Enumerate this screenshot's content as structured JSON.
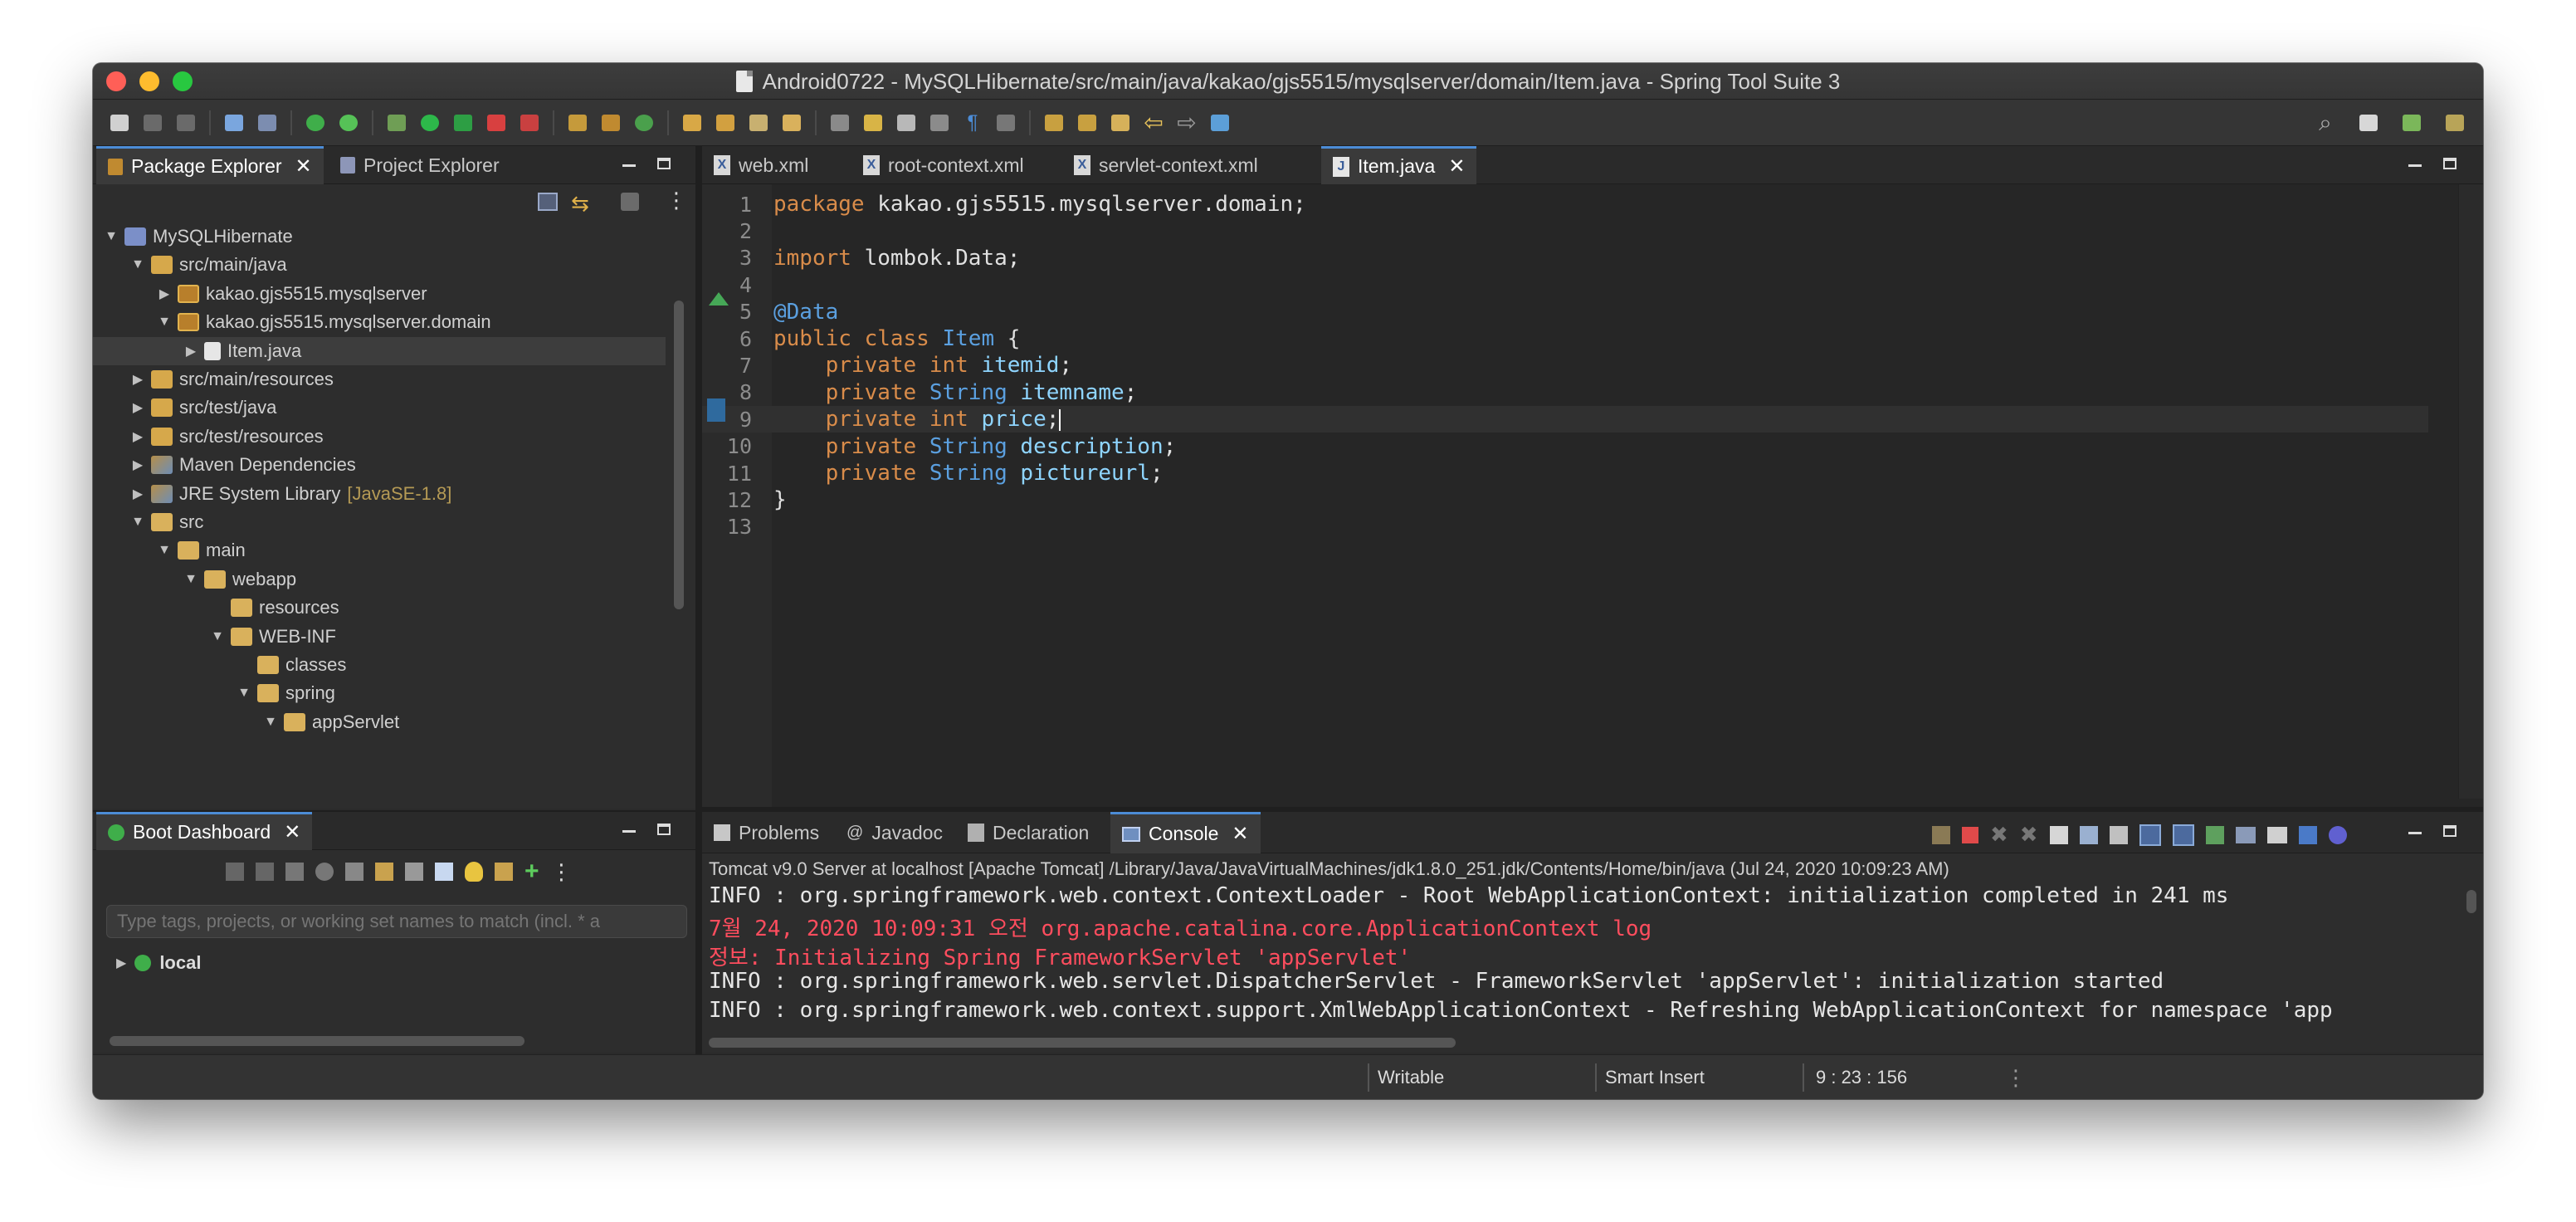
{
  "window": {
    "title": "Android0722 - MySQLHibernate/src/main/java/kakao/gjs5515/mysqlserver/domain/Item.java - Spring Tool Suite 3"
  },
  "package_explorer": {
    "tabs": [
      {
        "label": "Package Explorer",
        "active": true
      },
      {
        "label": "Project Explorer",
        "active": false
      }
    ],
    "tree": [
      {
        "label": "MySQLHibernate",
        "icon": "project-icon",
        "depth": 0,
        "twisty": "open"
      },
      {
        "label": "src/main/java",
        "icon": "source-folder-icon",
        "depth": 1,
        "twisty": "open"
      },
      {
        "label": "kakao.gjs5515.mysqlserver",
        "icon": "package-icon",
        "depth": 2,
        "twisty": "closed"
      },
      {
        "label": "kakao.gjs5515.mysqlserver.domain",
        "icon": "package-icon",
        "depth": 2,
        "twisty": "open"
      },
      {
        "label": "Item.java",
        "icon": "java-file-icon",
        "depth": 3,
        "twisty": "closed",
        "selected": true
      },
      {
        "label": "src/main/resources",
        "icon": "source-folder-icon",
        "depth": 1,
        "twisty": "closed"
      },
      {
        "label": "src/test/java",
        "icon": "source-folder-icon",
        "depth": 1,
        "twisty": "closed"
      },
      {
        "label": "src/test/resources",
        "icon": "source-folder-icon",
        "depth": 1,
        "twisty": "closed"
      },
      {
        "label": "Maven Dependencies",
        "icon": "library-icon",
        "depth": 1,
        "twisty": "closed"
      },
      {
        "label": "JRE System Library",
        "decoration": "[JavaSE-1.8]",
        "icon": "library-icon",
        "depth": 1,
        "twisty": "closed"
      },
      {
        "label": "src",
        "icon": "folder-icon",
        "depth": 1,
        "twisty": "open"
      },
      {
        "label": "main",
        "icon": "folder-icon",
        "depth": 2,
        "twisty": "open"
      },
      {
        "label": "webapp",
        "icon": "folder-icon",
        "depth": 3,
        "twisty": "open"
      },
      {
        "label": "resources",
        "icon": "folder-icon",
        "depth": 4,
        "twisty": "none"
      },
      {
        "label": "WEB-INF",
        "icon": "folder-icon",
        "depth": 4,
        "twisty": "open"
      },
      {
        "label": "classes",
        "icon": "folder-icon",
        "depth": 5,
        "twisty": "none"
      },
      {
        "label": "spring",
        "icon": "folder-icon",
        "depth": 5,
        "twisty": "open"
      },
      {
        "label": "appServlet",
        "icon": "folder-icon",
        "depth": 6,
        "twisty": "open"
      }
    ]
  },
  "boot_dashboard": {
    "tab_label": "Boot Dashboard",
    "filter_placeholder": "Type tags, projects, or working set names to match (incl. * a",
    "items": [
      {
        "label": "local"
      }
    ]
  },
  "editor": {
    "tabs": [
      {
        "label": "web.xml",
        "active": false
      },
      {
        "label": "root-context.xml",
        "active": false
      },
      {
        "label": "servlet-context.xml",
        "active": false
      },
      {
        "label": "Item.java",
        "active": true
      }
    ],
    "lines": [
      {
        "n": "1",
        "tokens": [
          {
            "t": "package",
            "c": "kw"
          },
          {
            "t": " kakao.gjs5515.mysqlserver.domain;",
            "c": ""
          }
        ]
      },
      {
        "n": "2",
        "tokens": []
      },
      {
        "n": "3",
        "tokens": [
          {
            "t": "import",
            "c": "kw"
          },
          {
            "t": " lombok.Data;",
            "c": ""
          }
        ]
      },
      {
        "n": "4",
        "tokens": []
      },
      {
        "n": "5",
        "tokens": [
          {
            "t": "@Data",
            "c": "anno"
          }
        ]
      },
      {
        "n": "6",
        "tokens": [
          {
            "t": "public class",
            "c": "kw"
          },
          {
            "t": " ",
            "c": ""
          },
          {
            "t": "Item",
            "c": "type"
          },
          {
            "t": " {",
            "c": ""
          }
        ]
      },
      {
        "n": "7",
        "tokens": [
          {
            "t": "    private int",
            "c": "kw"
          },
          {
            "t": " ",
            "c": ""
          },
          {
            "t": "itemid",
            "c": "field"
          },
          {
            "t": ";",
            "c": ""
          }
        ]
      },
      {
        "n": "8",
        "tokens": [
          {
            "t": "    private",
            "c": "kw"
          },
          {
            "t": " ",
            "c": ""
          },
          {
            "t": "String",
            "c": "type"
          },
          {
            "t": " ",
            "c": ""
          },
          {
            "t": "itemname",
            "c": "field"
          },
          {
            "t": ";",
            "c": ""
          }
        ]
      },
      {
        "n": "9",
        "tokens": [
          {
            "t": "    private int",
            "c": "kw"
          },
          {
            "t": " ",
            "c": ""
          },
          {
            "t": "price",
            "c": "field"
          },
          {
            "t": ";",
            "c": ""
          }
        ],
        "current": true
      },
      {
        "n": "10",
        "tokens": [
          {
            "t": "    private",
            "c": "kw"
          },
          {
            "t": " ",
            "c": ""
          },
          {
            "t": "String",
            "c": "type"
          },
          {
            "t": " ",
            "c": ""
          },
          {
            "t": "description",
            "c": "field"
          },
          {
            "t": ";",
            "c": ""
          }
        ]
      },
      {
        "n": "11",
        "tokens": [
          {
            "t": "    private",
            "c": "kw"
          },
          {
            "t": " ",
            "c": ""
          },
          {
            "t": "String",
            "c": "type"
          },
          {
            "t": " ",
            "c": ""
          },
          {
            "t": "pictureurl",
            "c": "field"
          },
          {
            "t": ";",
            "c": ""
          }
        ]
      },
      {
        "n": "12",
        "tokens": [
          {
            "t": "}",
            "c": ""
          }
        ]
      },
      {
        "n": "13",
        "tokens": []
      }
    ]
  },
  "console": {
    "tabs": [
      {
        "label": "Problems",
        "icon": "problems-icon",
        "active": false
      },
      {
        "label": "Javadoc",
        "icon": "javadoc-icon",
        "active": false
      },
      {
        "label": "Declaration",
        "icon": "declaration-icon",
        "active": false
      },
      {
        "label": "Console",
        "icon": "console-icon",
        "active": true
      }
    ],
    "process_label": "Tomcat v9.0 Server at localhost [Apache Tomcat] /Library/Java/JavaVirtualMachines/jdk1.8.0_251.jdk/Contents/Home/bin/java  (Jul 24, 2020 10:09:23 AM)",
    "lines": [
      {
        "text": "INFO : org.springframework.web.context.ContextLoader - Root WebApplicationContext: initialization completed in 241 ms",
        "color": "normal"
      },
      {
        "text": "7월 24, 2020 10:09:31 오전 org.apache.catalina.core.ApplicationContext log",
        "color": "red"
      },
      {
        "text": "정보: Initializing Spring FrameworkServlet 'appServlet'",
        "color": "red"
      },
      {
        "text": "INFO : org.springframework.web.servlet.DispatcherServlet - FrameworkServlet 'appServlet': initialization started",
        "color": "normal"
      },
      {
        "text": "INFO : org.springframework.web.context.support.XmlWebApplicationContext - Refreshing WebApplicationContext for namespace 'app",
        "color": "normal"
      }
    ]
  },
  "status_bar": {
    "writable": "Writable",
    "insert_mode": "Smart Insert",
    "position": "9 : 23 : 156"
  },
  "colors": {
    "accent": "#4c8cd6",
    "keyword": "#d98c4a",
    "type": "#5ba0e0",
    "field": "#8fd5ff",
    "error": "#ff4d5e"
  }
}
